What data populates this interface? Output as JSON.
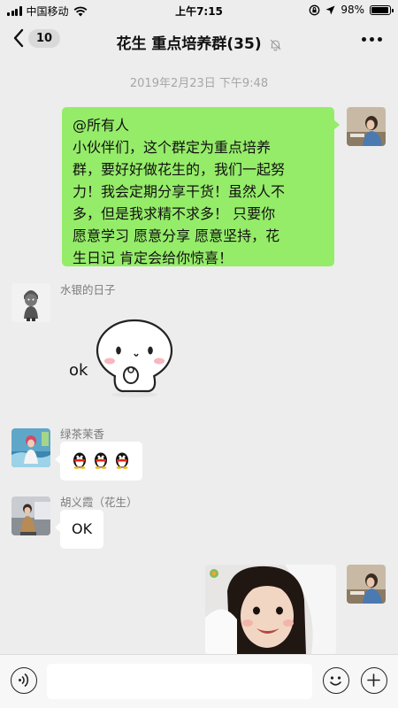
{
  "status_bar": {
    "carrier": "中国移动",
    "time": "上午7:15",
    "battery": "98%",
    "battery_level": 0.98
  },
  "header": {
    "unread_count": "10",
    "title": "花生 重点培养群(35)",
    "icons": {
      "back": "chevron-left-icon",
      "mute": "bell-off-icon",
      "more": "ellipsis-icon"
    }
  },
  "timestamp": "2019年2月23日 下午9:48",
  "messages": [
    {
      "side": "right",
      "type": "text",
      "lines": [
        "@所有人",
        "小伙伴们，这个群定为重点培养",
        "群，要好好做花生的，我们一起努",
        "力！我会定期分享干货！虽然人不",
        "多，但是我求精不求多！ 只要你",
        "愿意学习 愿意分享 愿意坚持，花",
        "生日记 肯定会给你惊喜！"
      ]
    },
    {
      "side": "left",
      "sender": "水银的日子",
      "type": "sticker",
      "sticker_text": "ok"
    },
    {
      "side": "left",
      "sender": "绿茶茉香",
      "type": "emoji",
      "emoji": "penguin-icon",
      "count": 3
    },
    {
      "side": "left",
      "sender": "胡义霞（花生）",
      "type": "text",
      "text": "OK"
    },
    {
      "side": "right",
      "type": "image",
      "image": "child-photo"
    }
  ],
  "input_bar": {
    "placeholder": "",
    "icons": {
      "voice": "voice-icon",
      "emoji": "smiley-icon",
      "plus": "plus-icon"
    }
  },
  "colors": {
    "background": "#ededed",
    "bubble_self": "#95ec69",
    "bubble_other": "#ffffff",
    "timestamp": "#a6a6a6"
  }
}
